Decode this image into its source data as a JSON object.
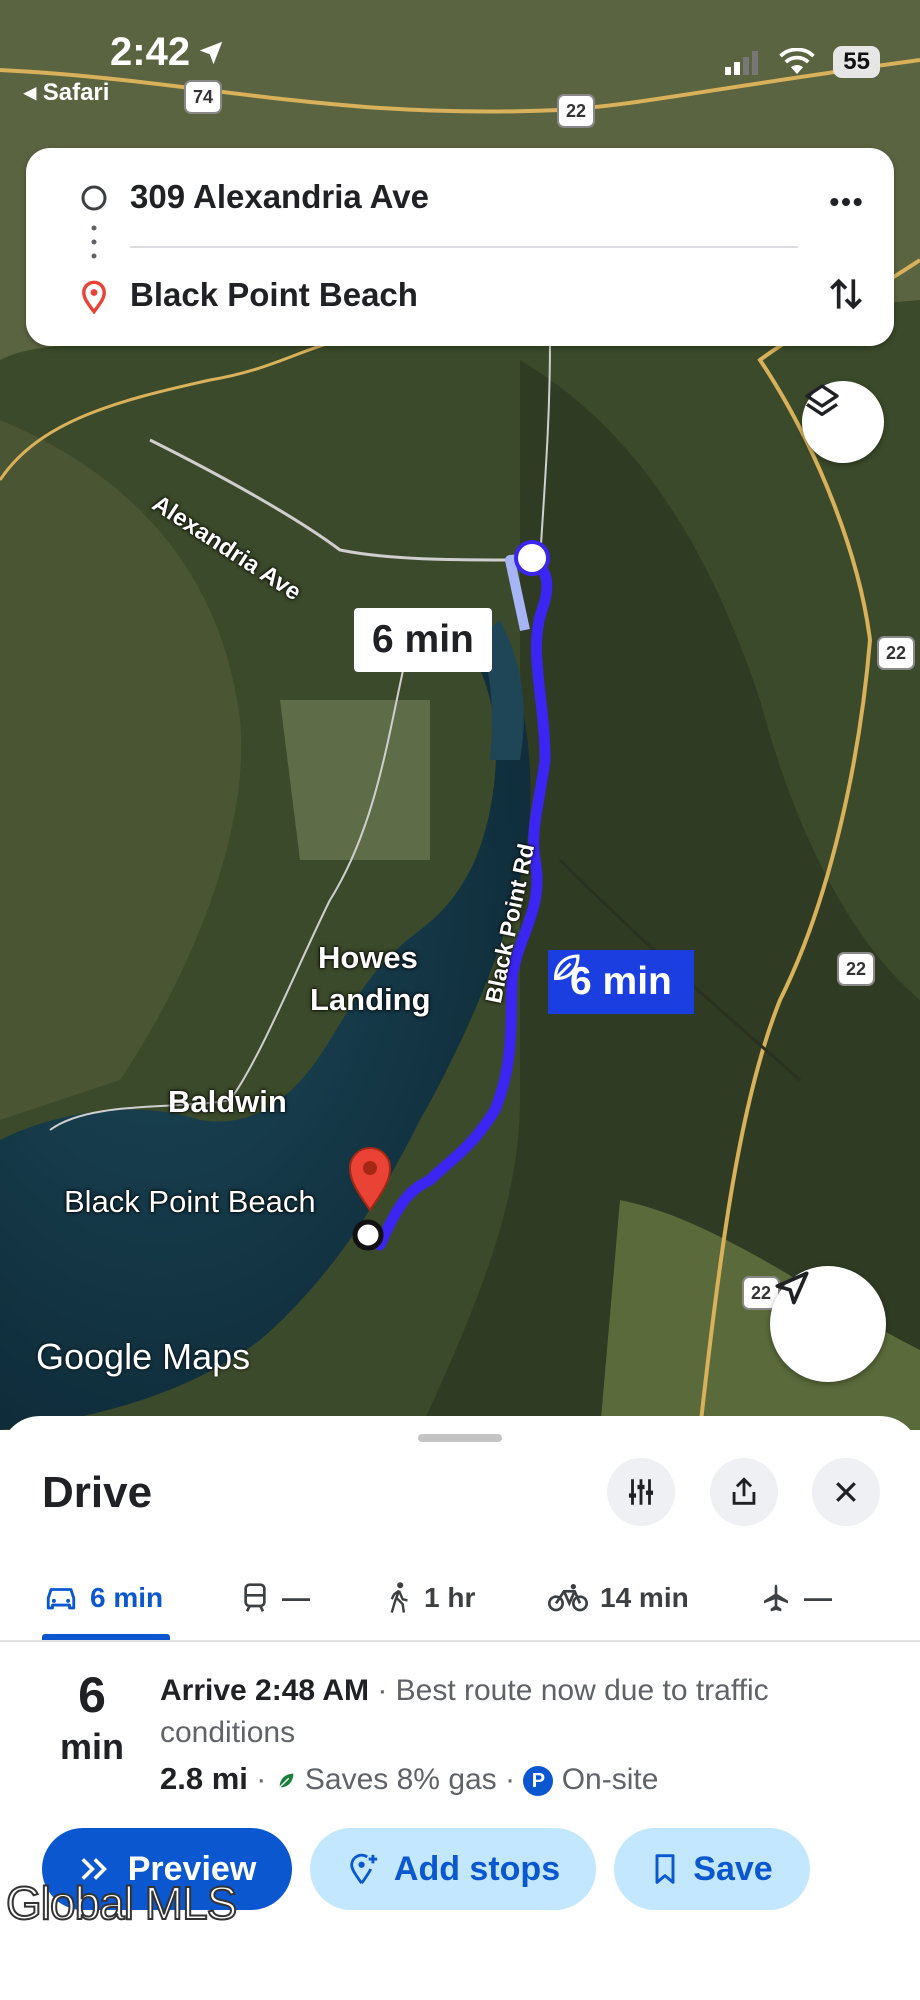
{
  "status": {
    "time": "2:42",
    "back": "◂ Safari",
    "battery": "55"
  },
  "route": {
    "origin": "309 Alexandria Ave",
    "destination": "Black Point Beach",
    "more_icon": "more-vert-icon",
    "swap_icon": "swap-vertical-icon"
  },
  "map": {
    "labels": {
      "alexandria": "Alexandria Ave",
      "black_point_rd": "Black Point Rd",
      "howes": "Howes",
      "landing": "Landing",
      "baldwin": "Baldwin",
      "beach": "Black Point Beach",
      "logo": "Google Maps"
    },
    "shields": [
      "74",
      "22",
      "22",
      "22",
      "22"
    ],
    "callouts": {
      "alt": "6 min",
      "primary": "6 min"
    },
    "colors": {
      "route": "#3b25f2",
      "route_alt": "#a6b5f5",
      "pin": "#ea4335"
    }
  },
  "sheet": {
    "title": "Drive",
    "modes": [
      {
        "icon": "car-icon",
        "label": "6 min"
      },
      {
        "icon": "transit-icon",
        "label": "—"
      },
      {
        "icon": "walk-icon",
        "label": "1 hr"
      },
      {
        "icon": "bike-icon",
        "label": "14 min"
      },
      {
        "icon": "plane-icon",
        "label": "—"
      }
    ],
    "duration": {
      "value": "6",
      "unit": "min"
    },
    "arrive": "Arrive 2:48 AM",
    "reason": " · Best route now due to traffic conditions",
    "distance": "2.8 mi",
    "gas": "Saves 8% gas",
    "parking_badge": "P",
    "parking": "On-site",
    "buttons": {
      "preview": "Preview",
      "add_stops": "Add stops",
      "save": "Save"
    },
    "accent": "#0b57d0"
  },
  "watermark": "Global MLS"
}
